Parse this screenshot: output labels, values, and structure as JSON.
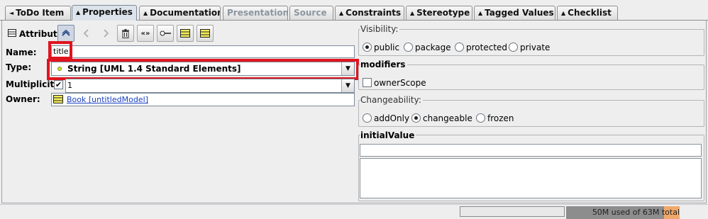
{
  "tabs": [
    {
      "label": "ToDo Item",
      "arrow": "◄",
      "state": "normal"
    },
    {
      "label": "Properties",
      "arrow": "▲",
      "state": "active"
    },
    {
      "label": "Documentation",
      "arrow": "▲",
      "state": "normal"
    },
    {
      "label": "Presentation",
      "arrow": "",
      "state": "disabled"
    },
    {
      "label": "Source",
      "arrow": "",
      "state": "disabled"
    },
    {
      "label": "Constraints",
      "arrow": "▲",
      "state": "normal"
    },
    {
      "label": "Stereotype",
      "arrow": "▲",
      "state": "normal"
    },
    {
      "label": "Tagged Values",
      "arrow": "▲",
      "state": "normal"
    },
    {
      "label": "Checklist",
      "arrow": "▲",
      "state": "normal"
    }
  ],
  "toolbar": {
    "title": "Attribute",
    "buttons": [
      {
        "icon": "navigate-up-icon",
        "state": "selected"
      },
      {
        "icon": "navigate-back-icon",
        "state": "disabled"
      },
      {
        "icon": "navigate-forward-icon",
        "state": "disabled"
      },
      {
        "icon": "trash-icon",
        "state": "normal"
      },
      {
        "icon": "new-datatype-icon",
        "state": "normal"
      },
      {
        "icon": "new-operation-icon",
        "state": "normal"
      },
      {
        "icon": "new-attribute-icon",
        "state": "normal"
      },
      {
        "icon": "new-class-icon",
        "state": "normal"
      }
    ]
  },
  "fields": {
    "name_label": "Name:",
    "name_value": "title",
    "type_label": "Type:",
    "type_value": "String [UML 1.4 Standard Elements]",
    "multiplicity_label": "Multiplicity:",
    "multiplicity_checked": true,
    "multiplicity_value": "1",
    "owner_label": "Owner:",
    "owner_value": "Book [untitledModel]"
  },
  "visibility": {
    "label": "Visibility:",
    "options": [
      "public",
      "package",
      "protected",
      "private"
    ],
    "selected": "public"
  },
  "modifiers": {
    "label": "modifiers",
    "options": [
      {
        "label": "ownerScope",
        "checked": false
      }
    ]
  },
  "changeability": {
    "label": "Changeability:",
    "options": [
      "addOnly",
      "changeable",
      "frozen"
    ],
    "selected": "changeable"
  },
  "initial_value": {
    "label": "initialValue",
    "value": ""
  },
  "status_bar": {
    "memory_text_used": "50M used of 63M ",
    "memory_text_total": "total",
    "memory_used_mb": 50,
    "memory_total_mb": 63
  },
  "colors": {
    "highlight_red": "#e0141e",
    "link_blue": "#1a3fc0",
    "memory_total_orange": "#f0a86a"
  }
}
